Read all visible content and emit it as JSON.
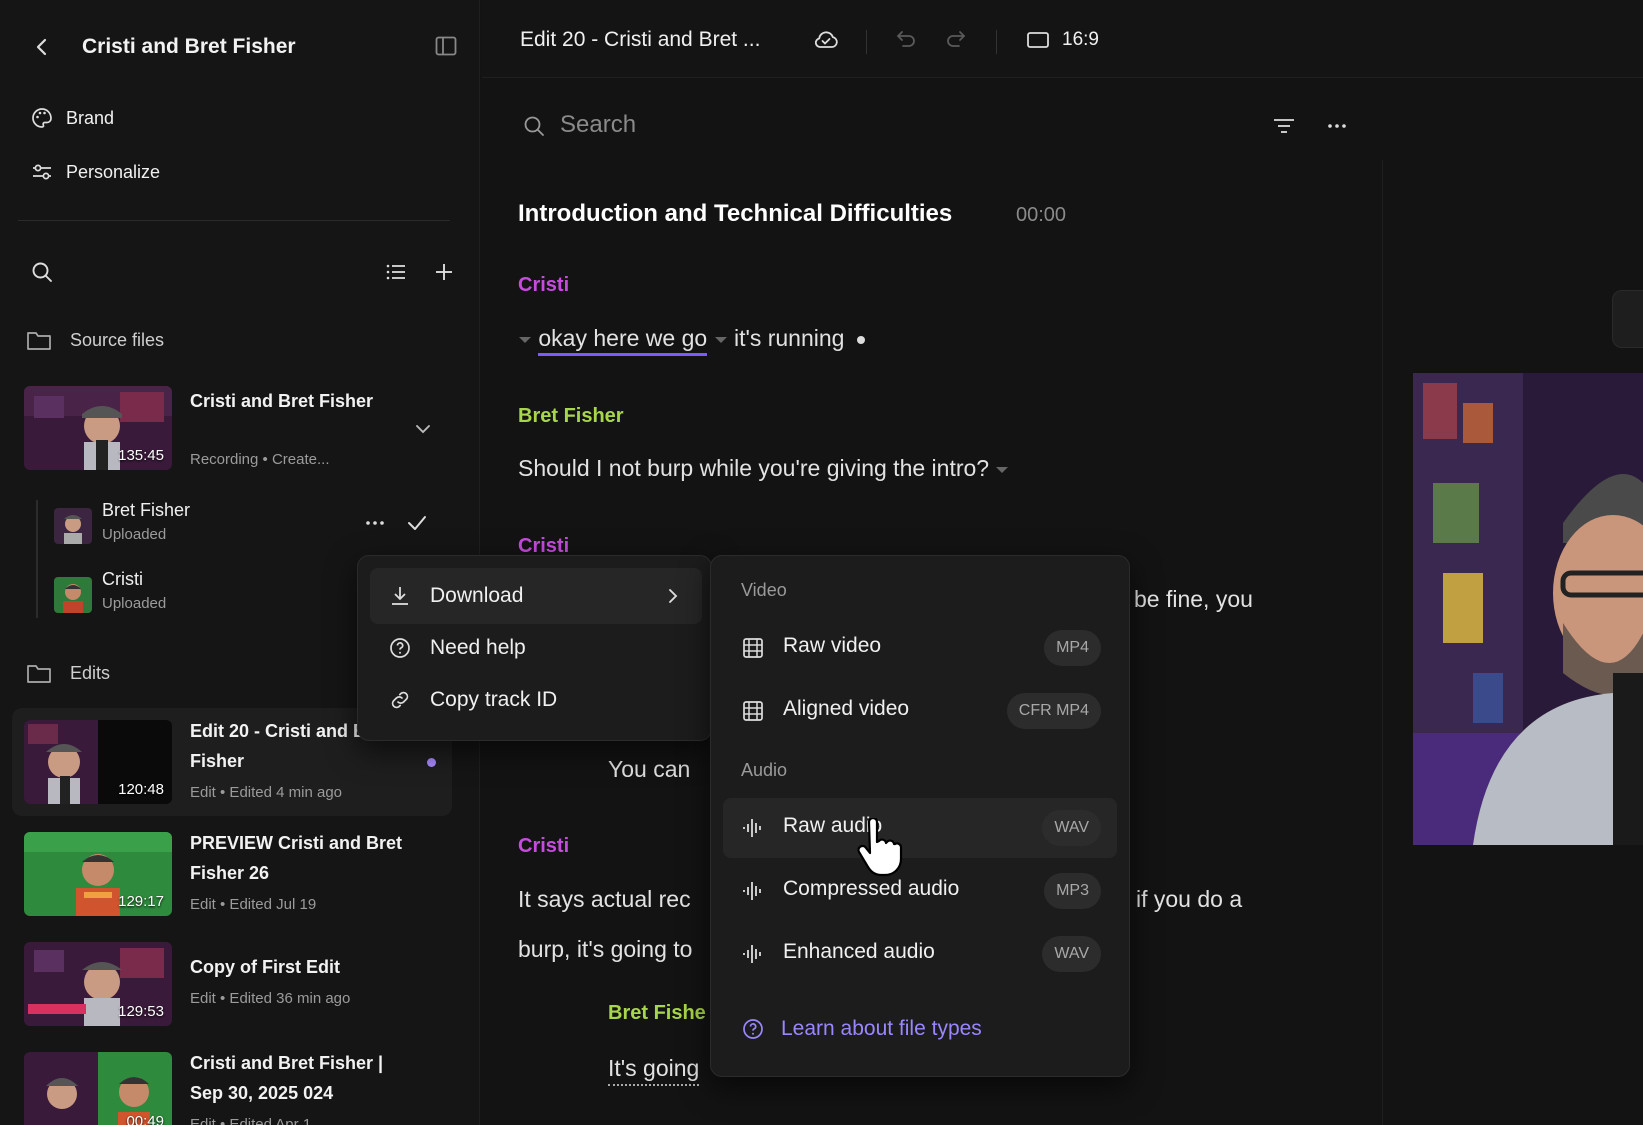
{
  "sidebar": {
    "title": "Cristi and Bret Fisher",
    "nav": [
      {
        "label": "Brand",
        "icon": "palette-icon"
      },
      {
        "label": "Personalize",
        "icon": "sliders-icon"
      }
    ],
    "source_files_label": "Source files",
    "edits_label": "Edits",
    "source": {
      "title": "Cristi and Bret Fisher",
      "meta": "Recording • Create...",
      "duration": "135:45",
      "tracks": [
        {
          "name": "Bret Fisher",
          "status": "Uploaded"
        },
        {
          "name": "Cristi",
          "status": "Uploaded"
        }
      ]
    },
    "edits": [
      {
        "title": "Edit 20 - Cristi and Bret Fisher",
        "meta": "Edit • Edited 4 min ago",
        "duration": "120:48"
      },
      {
        "title": "PREVIEW Cristi and Bret Fisher 26",
        "meta": "Edit • Edited Jul 19",
        "duration": "129:17"
      },
      {
        "title": "Copy of First Edit",
        "meta": "Edit • Edited 36 min ago",
        "duration": "129:53"
      },
      {
        "title": "Cristi and Bret Fisher | Sep 30, 2025 024",
        "meta": "Edit • Edited Apr 1",
        "duration": "00:49"
      }
    ]
  },
  "topbar": {
    "title": "Edit 20 - Cristi and Bret ...",
    "aspect_ratio": "16:9"
  },
  "transcript": {
    "search_placeholder": "Search",
    "chapter_title": "Introduction and Technical Difficulties",
    "chapter_time": "00:00",
    "blocks": [
      {
        "speaker": "Cristi",
        "text_a": "okay here we go",
        "text_b": "it's running"
      },
      {
        "speaker": "Bret Fisher",
        "text": "Should I not burp while you're giving the intro?"
      },
      {
        "speaker": "Cristi",
        "text": "be fine, you"
      },
      {
        "text": "You can"
      },
      {
        "speaker": "Cristi",
        "text_left": "It says actual rec",
        "text_right": "if you do a",
        "text_line2": "burp, it's going to"
      },
      {
        "speaker": "Bret Fishe",
        "text": "It's going"
      }
    ]
  },
  "context_menu": {
    "items": [
      {
        "label": "Download",
        "icon": "download-icon"
      },
      {
        "label": "Need help",
        "icon": "help-circle-icon"
      },
      {
        "label": "Copy track ID",
        "icon": "link-icon"
      }
    ]
  },
  "download_menu": {
    "video_header": "Video",
    "audio_header": "Audio",
    "video_items": [
      {
        "label": "Raw video",
        "badge": "MP4"
      },
      {
        "label": "Aligned video",
        "badge": "CFR MP4"
      }
    ],
    "audio_items": [
      {
        "label": "Raw audio",
        "badge": "WAV"
      },
      {
        "label": "Compressed audio",
        "badge": "MP3"
      },
      {
        "label": "Enhanced audio",
        "badge": "WAV"
      }
    ],
    "learn_link": "Learn about file types"
  },
  "colors": {
    "speaker_cristi": "#c84be0",
    "speaker_bret": "#a8d64a",
    "accent": "#9a86ff"
  }
}
